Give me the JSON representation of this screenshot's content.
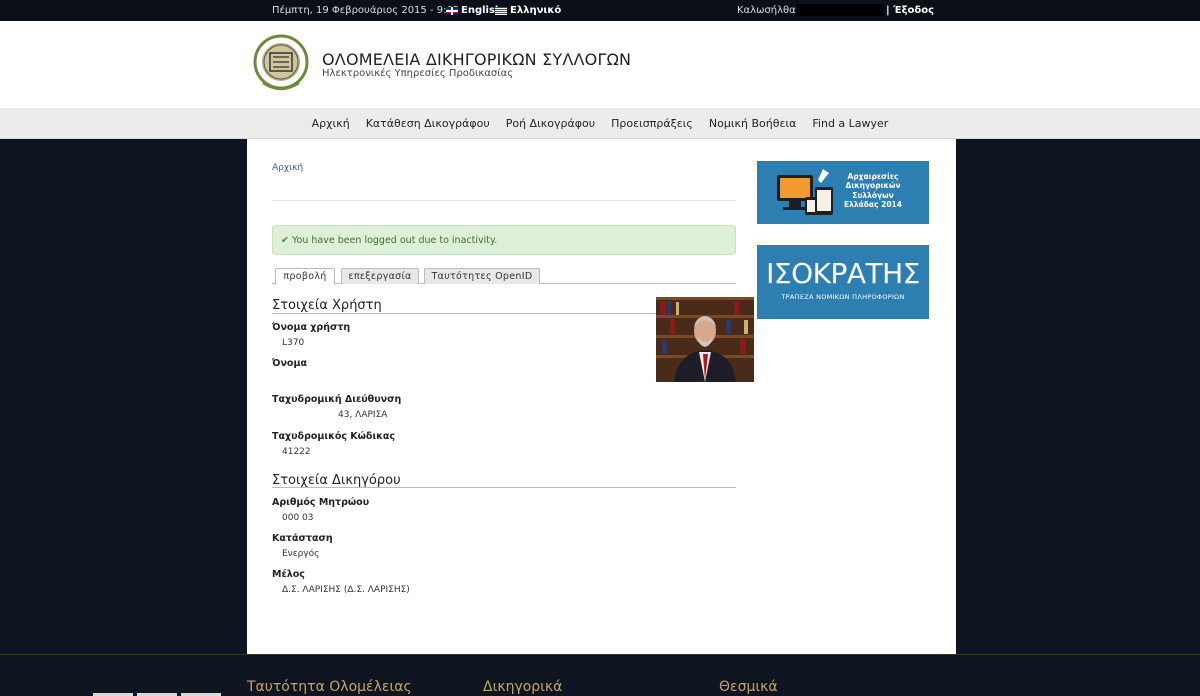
{
  "topbar": {
    "date": "Πέμπτη, 19 Φεβρουάριος 2015 - 9:02",
    "lang_en": "English",
    "lang_gr": "Ελληνικό",
    "welcome": "Καλωσήλθατε",
    "logout": "Έξοδος"
  },
  "header": {
    "title": "ΟΛΟΜΕΛΕΙΑ ΔΙΚΗΓΟΡΙΚΩΝ ΣΥΛΛΟΓΩΝ",
    "subtitle": "Ηλεκτρονικές Υπηρεσίες Προδικασίας"
  },
  "nav": {
    "items": [
      "Αρχική",
      "Κατάθεση Δικογράφου",
      "Ροή Δικογράφου",
      "Προεισπράξεις",
      "Νομική Βοήθεια",
      "Find a Lawyer"
    ]
  },
  "breadcrumb": "Αρχική",
  "alert": "You have been logged out due to inactivity.",
  "tabs": [
    "προβολή",
    "επεξεργασία",
    "Ταυτότητες OpenID"
  ],
  "user_section": {
    "heading": "Στοιχεία Χρήστη",
    "username_label": "Όνομα χρήστη",
    "username_value": "L370",
    "name_label": "Όνομα",
    "address_label": "Ταχυδρομική Διεύθυνση",
    "address_value": "43, ΛΑΡΙΣΑ",
    "postcode_label": "Ταχυδρομικός Κώδικας",
    "postcode_value": "41222"
  },
  "lawyer_section": {
    "heading": "Στοιχεία Δικηγόρου",
    "registry_label": "Αριθμός Μητρώου",
    "registry_value": "000 03",
    "status_label": "Κατάσταση",
    "status_value": "Ενεργός",
    "member_label": "Μέλος",
    "member_value": "Δ.Σ. ΛΑΡΙΣΗΣ (Δ.Σ. ΛΑΡΙΣΗΣ)"
  },
  "banner1": {
    "line1": "Αρχαιρεσίες",
    "line2": "Δικηγορικών",
    "line3": "Συλλόγων",
    "line4": "Ελλάδας 2014"
  },
  "banner2": {
    "title": "ΙΣΟΚΡΑΤΗΣ",
    "subtitle": "ΤΡΑΠΕΖΑ ΝΟΜΙΚΩΝ ΠΛΗΡΟΦΟΡΙΩΝ"
  },
  "footer": {
    "col1": "Ταυτότητα Ολομέλειας",
    "col2": "Δικηγορικά",
    "col3": "Θεσμικά"
  }
}
